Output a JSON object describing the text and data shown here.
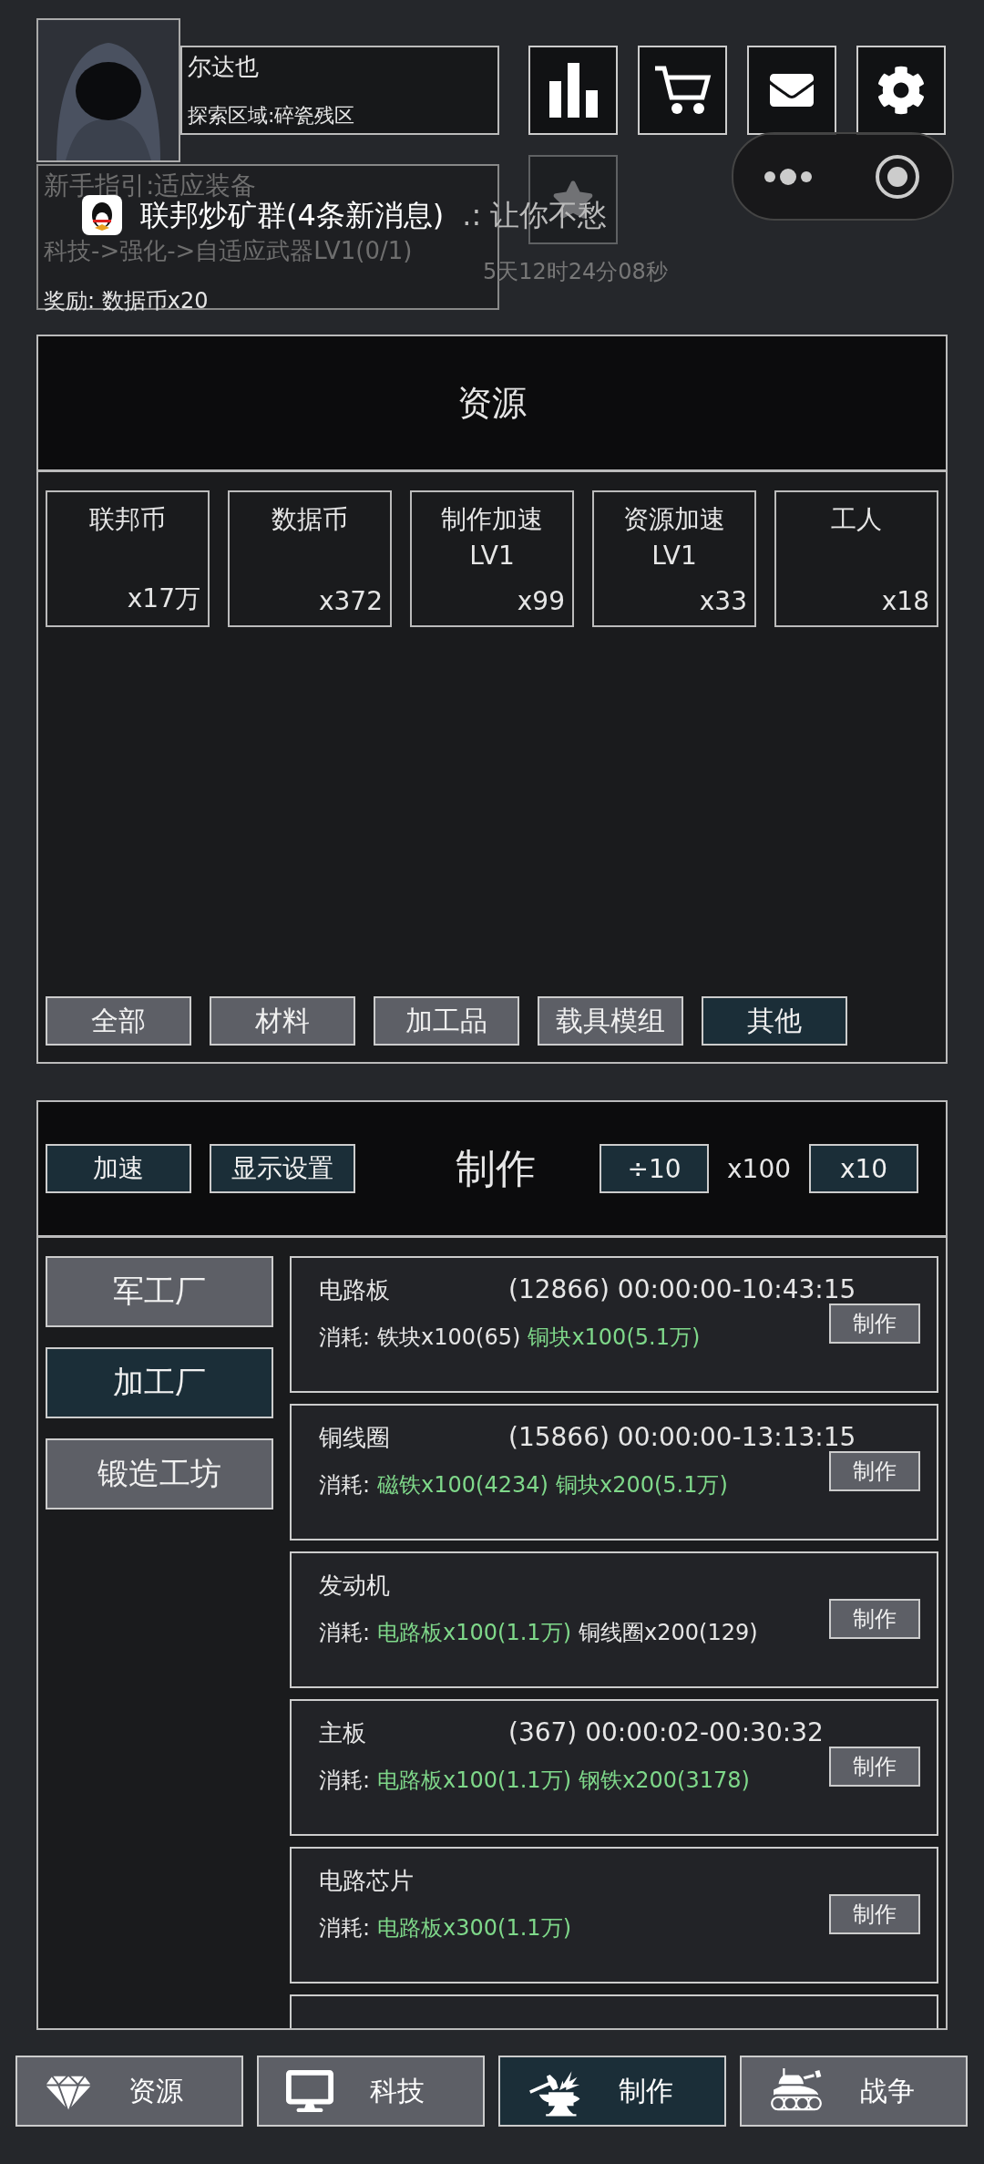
{
  "player": {
    "name": "尔达也",
    "area": "探索区域:碎瓷残区"
  },
  "top_buttons": [
    {
      "kind": "chart"
    },
    {
      "kind": "cart"
    },
    {
      "kind": "mail"
    },
    {
      "kind": "settings"
    }
  ],
  "star_button": {
    "disabled": true
  },
  "guide": {
    "title": "新手指引:适应装备",
    "task": "科技->强化->自适应武器LV1(0/1)",
    "reward": "奖励:  数据币x20"
  },
  "notification": {
    "group": "联邦炒矿群(4条新消息)",
    "message": ".: 让你不愁"
  },
  "timer": "5天12时24分08秒",
  "resources": {
    "title": "资源",
    "items": [
      {
        "name": "联邦币",
        "count": "x17万"
      },
      {
        "name": "数据币",
        "count": "x372"
      },
      {
        "name": "制作加速LV1",
        "count": "x99"
      },
      {
        "name": "资源加速LV1",
        "count": "x33"
      },
      {
        "name": "工人",
        "count": "x18"
      }
    ],
    "filters": [
      {
        "label": "全部",
        "selected": false
      },
      {
        "label": "材料",
        "selected": false
      },
      {
        "label": "加工品",
        "selected": false
      },
      {
        "label": "载具模组",
        "selected": false
      },
      {
        "label": "其他",
        "selected": true
      }
    ]
  },
  "crafting": {
    "title": "制作",
    "speed_button": "加速",
    "display_button": "显示设置",
    "divide_button": "÷10",
    "multiplier": "x100",
    "multiply_button": "x10",
    "factories": [
      {
        "label": "军工厂",
        "selected": false
      },
      {
        "label": "加工厂",
        "selected": true
      },
      {
        "label": "锻造工坊",
        "selected": false
      }
    ],
    "recipes": [
      {
        "name": "电路板",
        "info": "(12866) 00:00:00-10:43:15",
        "cost_label": "消耗:",
        "costs": [
          {
            "text": "铁块x100(65)",
            "enough": false
          },
          {
            "text": "铜块x100(5.1万)",
            "enough": true
          }
        ],
        "button": "制作"
      },
      {
        "name": "铜线圈",
        "info": "(15866) 00:00:00-13:13:15",
        "cost_label": "消耗:",
        "costs": [
          {
            "text": "磁铁x100(4234)",
            "enough": true
          },
          {
            "text": "铜块x200(5.1万)",
            "enough": true
          }
        ],
        "button": "制作"
      },
      {
        "name": "发动机",
        "cost_label": "消耗:",
        "costs": [
          {
            "text": "电路板x100(1.1万)",
            "enough": true
          },
          {
            "text": "铜线圈x200(129)",
            "enough": false
          }
        ],
        "button": "制作"
      },
      {
        "name": "主板",
        "info": "(367) 00:00:02-00:30:32",
        "cost_label": "消耗:",
        "costs": [
          {
            "text": "电路板x100(1.1万)",
            "enough": true
          },
          {
            "text": "钢铁x200(3178)",
            "enough": true
          }
        ],
        "button": "制作"
      },
      {
        "name": "电路芯片",
        "cost_label": "消耗:",
        "costs": [
          {
            "text": "电路板x300(1.1万)",
            "enough": true
          }
        ],
        "button": "制作"
      }
    ]
  },
  "nav": [
    {
      "label": "资源",
      "selected": false
    },
    {
      "label": "科技",
      "selected": false
    },
    {
      "label": "制作",
      "selected": true
    },
    {
      "label": "战争",
      "selected": false
    }
  ]
}
